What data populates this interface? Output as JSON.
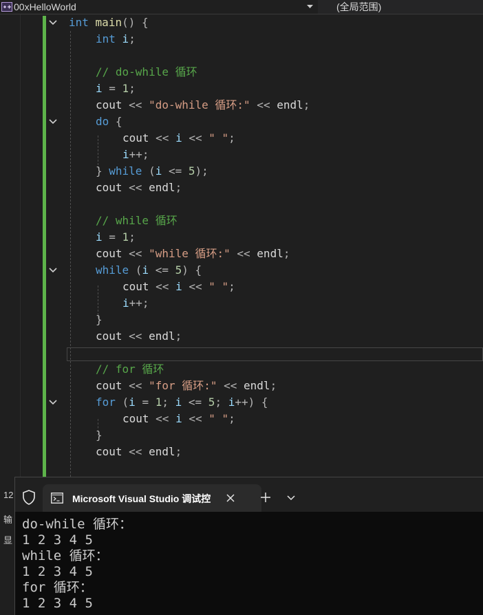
{
  "navbar": {
    "project": "00xHelloWorld",
    "scope": "(全局范围)"
  },
  "bottom_strip": {
    "line_number": "12",
    "label1": "输",
    "label2": "显"
  },
  "code_lines": [
    {
      "indent": 0,
      "fold": true,
      "tokens": [
        [
          "kw",
          "int"
        ],
        [
          "pl",
          " "
        ],
        [
          "fn",
          "main"
        ],
        [
          "op",
          "() {"
        ]
      ]
    },
    {
      "indent": 1,
      "fold": false,
      "tokens": [
        [
          "kw",
          "int"
        ],
        [
          "pl",
          " "
        ],
        [
          "id",
          "i"
        ],
        [
          "op",
          ";"
        ]
      ]
    },
    {
      "indent": 0,
      "fold": false,
      "tokens": []
    },
    {
      "indent": 1,
      "fold": false,
      "tokens": [
        [
          "cmt",
          "// do-while 循环"
        ]
      ]
    },
    {
      "indent": 1,
      "fold": false,
      "tokens": [
        [
          "id",
          "i"
        ],
        [
          "op",
          " = "
        ],
        [
          "num",
          "1"
        ],
        [
          "op",
          ";"
        ]
      ]
    },
    {
      "indent": 1,
      "fold": false,
      "tokens": [
        [
          "pl",
          "cout"
        ],
        [
          "op",
          " << "
        ],
        [
          "str",
          "\"do-while 循环:\""
        ],
        [
          "op",
          " << "
        ],
        [
          "pl",
          "endl"
        ],
        [
          "op",
          ";"
        ]
      ]
    },
    {
      "indent": 1,
      "fold": true,
      "tokens": [
        [
          "kw",
          "do"
        ],
        [
          "op",
          " {"
        ]
      ]
    },
    {
      "indent": 2,
      "fold": false,
      "tokens": [
        [
          "pl",
          "cout"
        ],
        [
          "op",
          " << "
        ],
        [
          "id",
          "i"
        ],
        [
          "op",
          " << "
        ],
        [
          "str",
          "\" \""
        ],
        [
          "op",
          ";"
        ]
      ]
    },
    {
      "indent": 2,
      "fold": false,
      "tokens": [
        [
          "id",
          "i"
        ],
        [
          "op",
          "++;"
        ]
      ]
    },
    {
      "indent": 1,
      "fold": false,
      "tokens": [
        [
          "op",
          "} "
        ],
        [
          "kw",
          "while"
        ],
        [
          "op",
          " ("
        ],
        [
          "id",
          "i"
        ],
        [
          "op",
          " <= "
        ],
        [
          "num",
          "5"
        ],
        [
          "op",
          ");"
        ]
      ]
    },
    {
      "indent": 1,
      "fold": false,
      "tokens": [
        [
          "pl",
          "cout"
        ],
        [
          "op",
          " << "
        ],
        [
          "pl",
          "endl"
        ],
        [
          "op",
          ";"
        ]
      ]
    },
    {
      "indent": 0,
      "fold": false,
      "tokens": []
    },
    {
      "indent": 1,
      "fold": false,
      "tokens": [
        [
          "cmt",
          "// while 循环"
        ]
      ]
    },
    {
      "indent": 1,
      "fold": false,
      "tokens": [
        [
          "id",
          "i"
        ],
        [
          "op",
          " = "
        ],
        [
          "num",
          "1"
        ],
        [
          "op",
          ";"
        ]
      ]
    },
    {
      "indent": 1,
      "fold": false,
      "tokens": [
        [
          "pl",
          "cout"
        ],
        [
          "op",
          " << "
        ],
        [
          "str",
          "\"while 循环:\""
        ],
        [
          "op",
          " << "
        ],
        [
          "pl",
          "endl"
        ],
        [
          "op",
          ";"
        ]
      ]
    },
    {
      "indent": 1,
      "fold": true,
      "tokens": [
        [
          "kw",
          "while"
        ],
        [
          "op",
          " ("
        ],
        [
          "id",
          "i"
        ],
        [
          "op",
          " <= "
        ],
        [
          "num",
          "5"
        ],
        [
          "op",
          ") {"
        ]
      ]
    },
    {
      "indent": 2,
      "fold": false,
      "tokens": [
        [
          "pl",
          "cout"
        ],
        [
          "op",
          " << "
        ],
        [
          "id",
          "i"
        ],
        [
          "op",
          " << "
        ],
        [
          "str",
          "\" \""
        ],
        [
          "op",
          ";"
        ]
      ]
    },
    {
      "indent": 2,
      "fold": false,
      "tokens": [
        [
          "id",
          "i"
        ],
        [
          "op",
          "++;"
        ]
      ]
    },
    {
      "indent": 1,
      "fold": false,
      "tokens": [
        [
          "op",
          "}"
        ]
      ]
    },
    {
      "indent": 1,
      "fold": false,
      "tokens": [
        [
          "pl",
          "cout"
        ],
        [
          "op",
          " << "
        ],
        [
          "pl",
          "endl"
        ],
        [
          "op",
          ";"
        ]
      ]
    },
    {
      "indent": 0,
      "fold": false,
      "tokens": []
    },
    {
      "indent": 1,
      "fold": false,
      "tokens": [
        [
          "cmt",
          "// for 循环"
        ]
      ]
    },
    {
      "indent": 1,
      "fold": false,
      "tokens": [
        [
          "pl",
          "cout"
        ],
        [
          "op",
          " << "
        ],
        [
          "str",
          "\"for 循环:\""
        ],
        [
          "op",
          " << "
        ],
        [
          "pl",
          "endl"
        ],
        [
          "op",
          ";"
        ]
      ]
    },
    {
      "indent": 1,
      "fold": true,
      "tokens": [
        [
          "kw",
          "for"
        ],
        [
          "op",
          " ("
        ],
        [
          "id",
          "i"
        ],
        [
          "op",
          " = "
        ],
        [
          "num",
          "1"
        ],
        [
          "op",
          "; "
        ],
        [
          "id",
          "i"
        ],
        [
          "op",
          " <= "
        ],
        [
          "num",
          "5"
        ],
        [
          "op",
          "; "
        ],
        [
          "id",
          "i"
        ],
        [
          "op",
          "++) {"
        ]
      ]
    },
    {
      "indent": 2,
      "fold": false,
      "tokens": [
        [
          "pl",
          "cout"
        ],
        [
          "op",
          " << "
        ],
        [
          "id",
          "i"
        ],
        [
          "op",
          " << "
        ],
        [
          "str",
          "\" \""
        ],
        [
          "op",
          ";"
        ]
      ]
    },
    {
      "indent": 1,
      "fold": false,
      "tokens": [
        [
          "op",
          "}"
        ]
      ]
    },
    {
      "indent": 1,
      "fold": false,
      "tokens": [
        [
          "pl",
          "cout"
        ],
        [
          "op",
          " << "
        ],
        [
          "pl",
          "endl"
        ],
        [
          "op",
          ";"
        ]
      ]
    }
  ],
  "terminal": {
    "tab_title": "Microsoft Visual Studio 调试控",
    "output": [
      "do-while 循环：",
      "1 2 3 4 5",
      "while 循环：",
      "1 2 3 4 5",
      "for 循环：",
      "1 2 3 4 5"
    ]
  }
}
